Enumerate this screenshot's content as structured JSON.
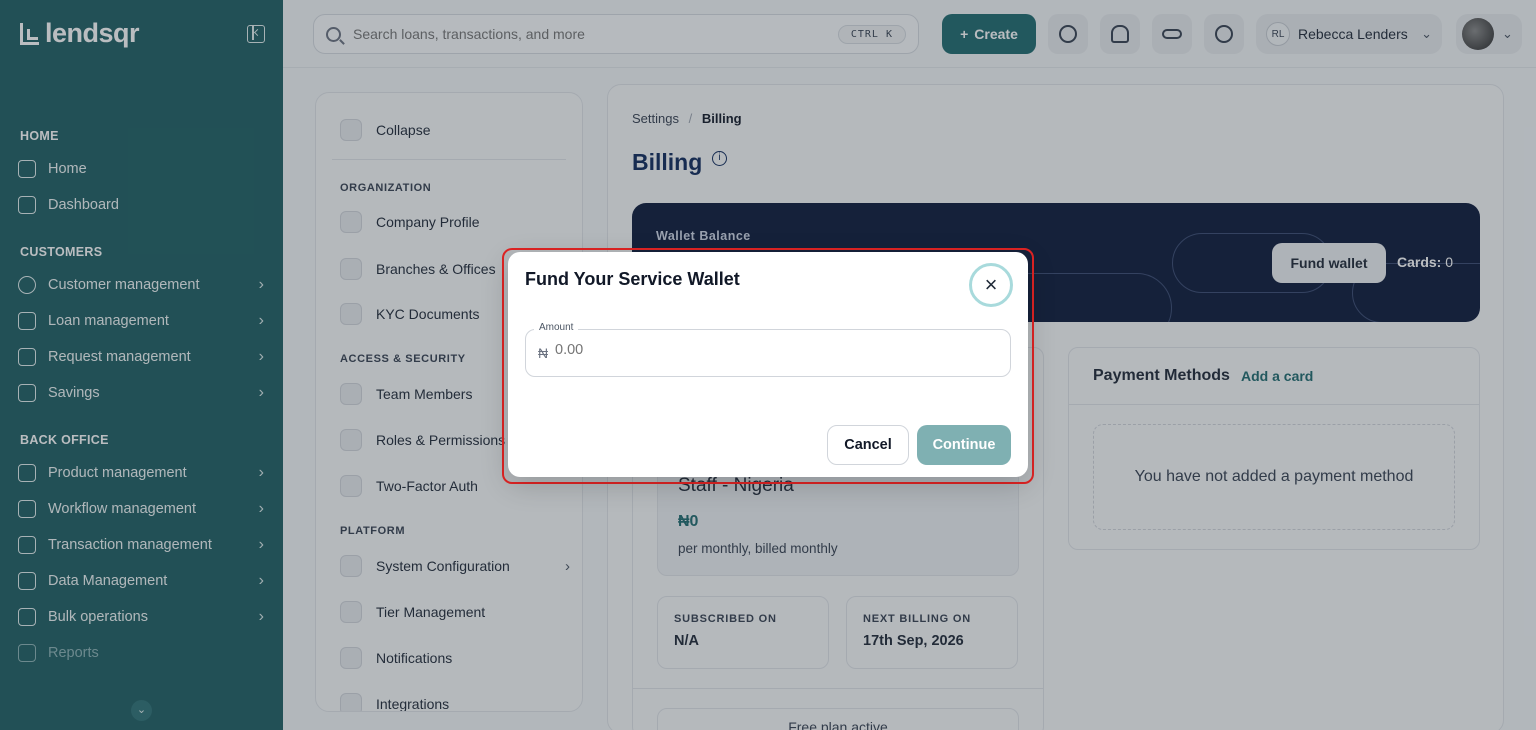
{
  "brand": {
    "name": "lendsqr"
  },
  "sidebar": {
    "sections": [
      {
        "title": "HOME",
        "items": [
          {
            "label": "Home",
            "icon": "home-icon"
          },
          {
            "label": "Dashboard",
            "icon": "dashboard-icon"
          }
        ]
      },
      {
        "title": "CUSTOMERS",
        "items": [
          {
            "label": "Customer management",
            "icon": "users-icon"
          },
          {
            "label": "Loan management",
            "icon": "loan-icon"
          },
          {
            "label": "Request management",
            "icon": "inbox-icon"
          },
          {
            "label": "Savings",
            "icon": "building-icon"
          }
        ]
      },
      {
        "title": "BACK OFFICE",
        "items": [
          {
            "label": "Product management",
            "icon": "box-icon"
          },
          {
            "label": "Workflow management",
            "icon": "workflow-icon"
          },
          {
            "label": "Transaction management",
            "icon": "swap-icon"
          },
          {
            "label": "Data Management",
            "icon": "chart-icon"
          },
          {
            "label": "Bulk operations",
            "icon": "inbox-icon"
          },
          {
            "label": "Reports",
            "icon": "reports-icon"
          }
        ]
      }
    ]
  },
  "topbar": {
    "search_placeholder": "Search loans, transactions, and more",
    "shortcut": "CTRL  K",
    "create_label": "Create",
    "user_initials": "RL",
    "user_name": "Rebecca Lenders"
  },
  "settings_menu": {
    "collapse_label": "Collapse",
    "org_title": "ORGANIZATION",
    "org_items": [
      "Company Profile",
      "Branches & Offices",
      "KYC Documents"
    ],
    "access_title": "ACCESS & SECURITY",
    "access_items": [
      "Team Members",
      "Roles & Permissions",
      "Two-Factor Auth"
    ],
    "platform_title": "PLATFORM",
    "platform_items": [
      "System Configuration",
      "Tier Management",
      "Notifications",
      "Integrations"
    ]
  },
  "billing": {
    "breadcrumb_parent": "Settings",
    "breadcrumb_sep": "/",
    "breadcrumb_current": "Billing",
    "title": "Billing",
    "wallet_label": "Wallet Balance",
    "fund_wallet_label": "Fund wallet",
    "cards_label": "Cards:",
    "cards_count": "0",
    "plan_name": "Staff - Nigeria",
    "plan_price": "₦0",
    "plan_note": "per monthly, billed monthly",
    "subscribed_label": "SUBSCRIBED ON",
    "subscribed_value": "N/A",
    "next_billing_label": "NEXT BILLING ON",
    "next_billing_value": "17th Sep, 2026",
    "free_plan_label": "Free plan active",
    "payment_title": "Payment Methods",
    "add_card_label": "Add a card",
    "payment_empty": "You have not added a payment method"
  },
  "modal": {
    "title": "Fund Your Service Wallet",
    "amount_label": "Amount",
    "currency_symbol": "₦",
    "amount_placeholder": "0.00",
    "cancel_label": "Cancel",
    "continue_label": "Continue"
  },
  "colors": {
    "sidebar": "#1f5f63",
    "accent": "#1f6b6f",
    "wallet_card": "#0d1a3a",
    "highlight": "#e02424"
  }
}
